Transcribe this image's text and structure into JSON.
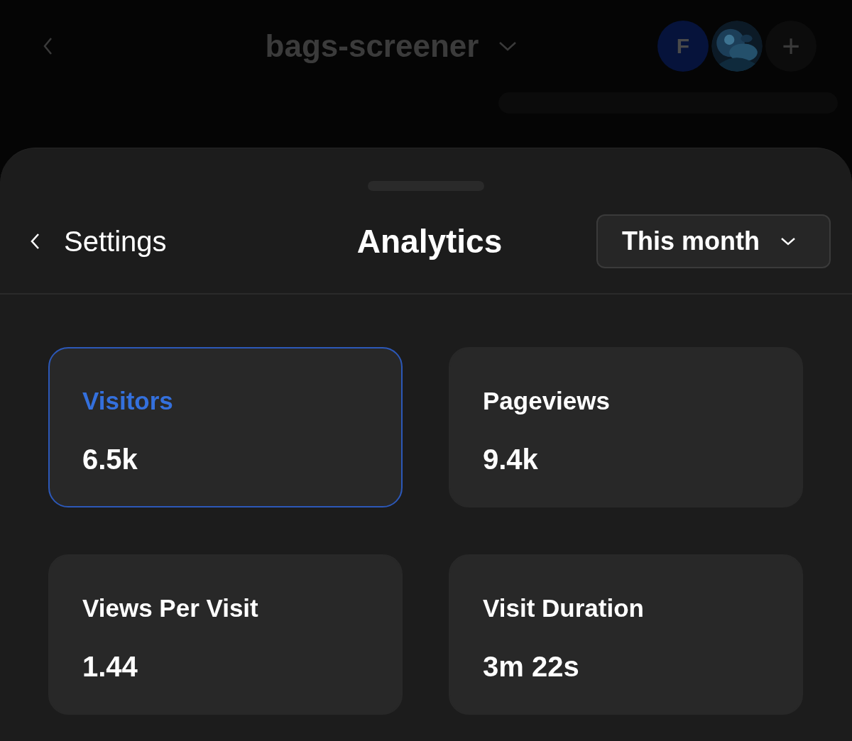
{
  "top_bar": {
    "title": "bags-screener",
    "avatars": [
      {
        "kind": "initial",
        "initial": "F"
      },
      {
        "kind": "picture"
      }
    ],
    "add_button": "+"
  },
  "sheet": {
    "back_label": "Settings",
    "title": "Analytics",
    "period": "This month"
  },
  "metrics": [
    {
      "label": "Visitors",
      "value": "6.5k",
      "selected": true
    },
    {
      "label": "Pageviews",
      "value": "9.4k",
      "selected": false
    },
    {
      "label": "Views Per Visit",
      "value": "1.44",
      "selected": false
    },
    {
      "label": "Visit Duration",
      "value": "3m 22s",
      "selected": false
    }
  ]
}
